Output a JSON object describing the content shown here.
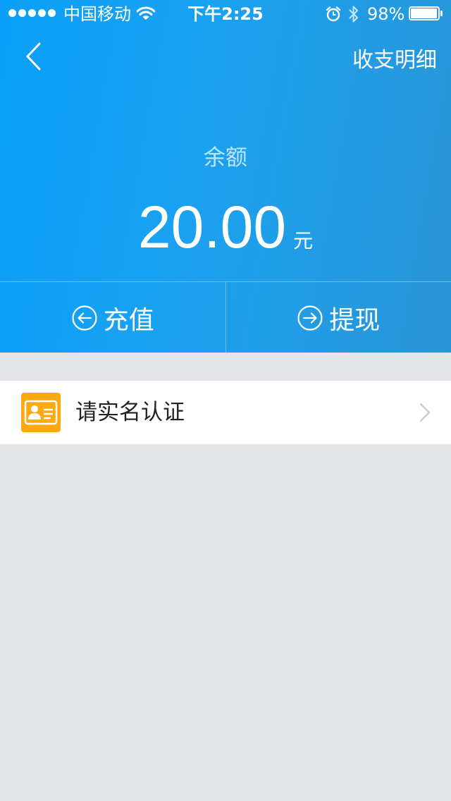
{
  "status_bar": {
    "carrier": "中国移动",
    "time": "下午2:25",
    "battery_percent": "98%",
    "battery_level": 0.98,
    "signal_dots": 5
  },
  "nav": {
    "details_label": "收支明细"
  },
  "balance": {
    "label": "余额",
    "amount": "20.00",
    "unit": "元"
  },
  "actions": {
    "recharge_label": "充值",
    "withdraw_label": "提现"
  },
  "verify": {
    "label": "请实名认证"
  },
  "colors": {
    "header_start": "#0aa0f8",
    "header_end": "#2a95d6",
    "page_background": "#e4e5e9",
    "id_card_icon": "#fda90f",
    "chevron": "#c7c7cc"
  },
  "icons": {
    "back": "chevron-left-icon",
    "recharge": "arrow-left-circle-icon",
    "withdraw": "arrow-right-circle-icon",
    "verify": "id-card-icon",
    "row_arrow": "chevron-right-icon"
  }
}
